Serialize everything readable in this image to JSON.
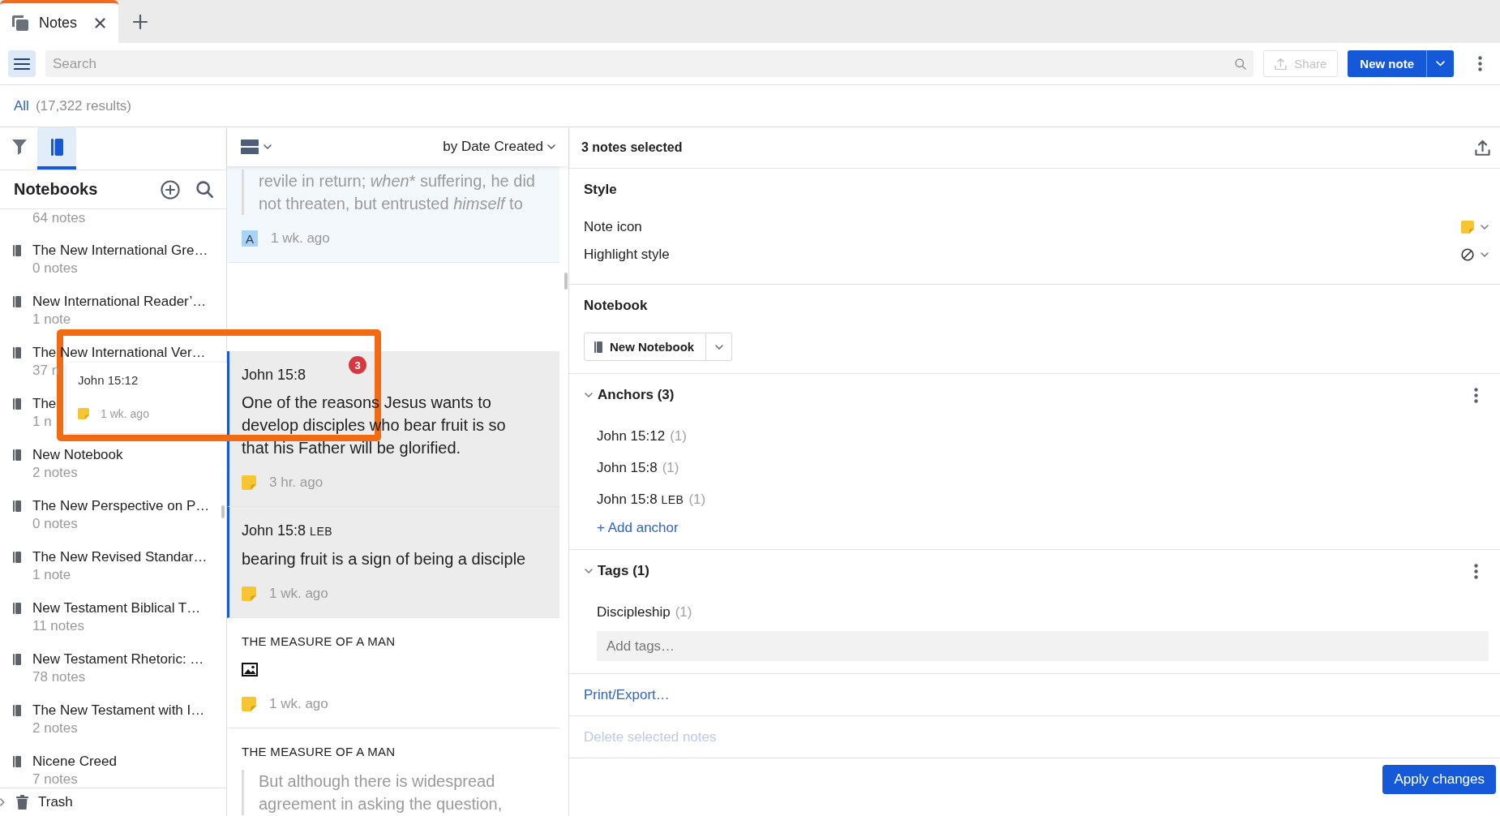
{
  "tabs": [
    {
      "label": "Notes",
      "selected": true
    }
  ],
  "toolbar": {
    "search": {
      "placeholder": "Search"
    },
    "share": {
      "label": "Share",
      "disabled": true
    },
    "new_note": {
      "label": "New note"
    }
  },
  "results": {
    "scope": "All",
    "count": "(17,322 results)"
  },
  "sidebar": {
    "tabs": [
      {
        "kind": "filter",
        "selected": false
      },
      {
        "kind": "notebooks",
        "selected": true
      }
    ],
    "title": "Notebooks",
    "items": [
      {
        "count": "64 notes"
      },
      {
        "title": "The New International Gre…",
        "count": "0 notes"
      },
      {
        "title": "New International Reader’…",
        "count": "1 note"
      },
      {
        "title": "The New International Ver…",
        "count": "37 n"
      },
      {
        "title": "The",
        "count": "1 n"
      },
      {
        "title": "New Notebook",
        "count": "2 notes"
      },
      {
        "title": "The New Perspective on P…",
        "count": "0 notes"
      },
      {
        "title": "The New Revised Standar…",
        "count": "1 note"
      },
      {
        "title": "New Testament Biblical T…",
        "count": "11 notes"
      },
      {
        "title": "New Testament Rhetoric: …",
        "count": "78 notes"
      },
      {
        "title": "The New Testament with I…",
        "count": "2 notes"
      },
      {
        "title": "Nicene Creed",
        "count": "7 notes"
      }
    ],
    "trash": "Trash"
  },
  "notes_list": {
    "sort": "by Date Created",
    "notes": [
      {
        "kind": "quote",
        "quote": [
          {
            "text": "revile in return; "
          },
          {
            "text": "when",
            "italic": true
          },
          {
            "text": "* suffering, he did not threaten, but entrusted "
          },
          {
            "text": "himself",
            "italic": true
          },
          {
            "text": " to"
          }
        ],
        "marker": {
          "kind": "letter",
          "text": "A"
        },
        "time": "1 wk. ago",
        "selected": false,
        "hovered": true
      },
      {
        "kind": "drop_placeholder"
      },
      {
        "kind": "text",
        "reference": "John 15:8",
        "body": "One of the reasons Jesus wants to develop disciples who bear fruit is so that his Father will be glorified.",
        "marker": {
          "kind": "sticky"
        },
        "time": "3 hr. ago",
        "selected": true
      },
      {
        "kind": "text",
        "reference": "John 15:8",
        "version": "LEB",
        "body": "bearing fruit is a sign of being a disciple",
        "marker": {
          "kind": "sticky"
        },
        "time": "1 wk. ago",
        "selected": true
      },
      {
        "kind": "image",
        "title": "THE MEASURE OF A MAN",
        "marker": {
          "kind": "sticky"
        },
        "time": "1 wk. ago",
        "selected": false
      },
      {
        "kind": "quote",
        "title": "THE MEASURE OF A MAN",
        "quote": [
          {
            "text": "But although there is widespread agreement in asking the question,"
          }
        ],
        "selected": false
      }
    ]
  },
  "detail": {
    "header": "3 notes selected",
    "style": {
      "title": "Style",
      "rows": [
        {
          "kind": "note_icon",
          "label": "Note icon"
        },
        {
          "kind": "highlight",
          "label": "Highlight style"
        }
      ]
    },
    "notebook": {
      "title": "Notebook",
      "value": "New Notebook"
    },
    "anchors": {
      "title": "Anchors (3)",
      "expanded": true,
      "items": [
        {
          "reference": "John 15:12",
          "count": "(1)"
        },
        {
          "reference": "John 15:8",
          "count": "(1)"
        },
        {
          "reference": "John 15:8",
          "version": "LEB",
          "count": "(1)"
        }
      ],
      "add": "+ Add anchor"
    },
    "tags": {
      "title": "Tags (1)",
      "expanded": true,
      "items": [
        {
          "reference": "Discipleship",
          "count": "(1)"
        }
      ],
      "input": {
        "placeholder": "Add tags…"
      }
    },
    "print": "Print/Export…",
    "delete": {
      "label": "Delete selected notes",
      "disabled": true
    },
    "apply": "Apply changes"
  },
  "drag_preview": {
    "title": "John 15:12",
    "marker": {
      "kind": "sticky"
    },
    "time": "1 wk. ago",
    "count": "3"
  }
}
